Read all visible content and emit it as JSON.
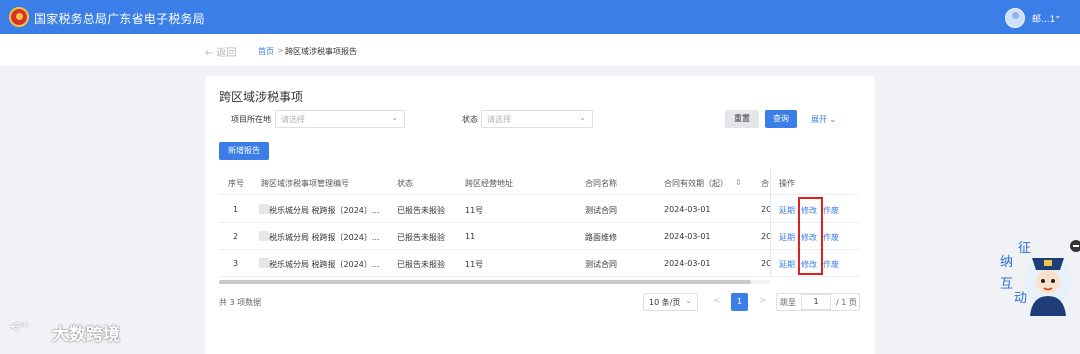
{
  "header": {
    "title": "国家税务总局广东省电子税务局",
    "user_name": "邮...1",
    "caret": "⌄"
  },
  "nav": {
    "back_label": "← 返回",
    "breadcrumb_home": "首页",
    "breadcrumb_sep": ">",
    "breadcrumb_current": "跨区域涉税事项报告"
  },
  "page": {
    "title": "跨区域涉税事项"
  },
  "filters": {
    "location_label": "项目所在地",
    "location_placeholder": "请选择",
    "status_label": "状态",
    "status_placeholder": "请选择",
    "reset_label": "重置",
    "query_label": "查询",
    "expand_label": "展开 ⌄",
    "add_label": "新增报告"
  },
  "table": {
    "columns": {
      "index": "序号",
      "code": "跨区域涉税事项管理编号",
      "status": "状态",
      "address": "跨区经营地址",
      "contract_name": "合同名称",
      "validity_start": "合同有效期（起）",
      "sort_icon": "⇕",
      "validity_end_partial": "合",
      "actions": "操作"
    },
    "rows": [
      {
        "index": "1",
        "code": "税乐城分局 税跨报〔2024〕...",
        "status": "已报告未报验",
        "address": "11号",
        "contract_name": "测试合同",
        "validity_start": "2024-03-01",
        "validity_end_partial": "2C",
        "action_extend": "延期",
        "action_modify": "修改",
        "action_void": "作废"
      },
      {
        "index": "2",
        "code": "税乐城分局 税跨报〔2024〕...",
        "status": "已报告未报验",
        "address": "11",
        "contract_name": "路面维修",
        "validity_start": "2024-03-01",
        "validity_end_partial": "2C",
        "action_extend": "延期",
        "action_modify": "修改",
        "action_void": "作废"
      },
      {
        "index": "3",
        "code": "税乐城分局 税跨报〔2024〕...",
        "status": "已报告未报验",
        "address": "11号",
        "contract_name": "测试合同",
        "validity_start": "2024-03-01",
        "validity_end_partial": "2C",
        "action_extend": "延期",
        "action_modify": "修改",
        "action_void": "作废"
      }
    ]
  },
  "pagination": {
    "total_label": "共 3 项数据",
    "page_size": "10 条/页",
    "size_caret": "⌄",
    "prev": "<",
    "current_page": "1",
    "next": ">",
    "jump_label": "跳至",
    "jump_value": "1",
    "total_pages": "/ 1 页"
  },
  "watermark": {
    "icon": "ᗕ⁰⁰",
    "text": "大数跨境"
  },
  "mascot": {
    "chars": [
      "征",
      "纳",
      "互",
      "动"
    ]
  },
  "colors": {
    "primary": "#3b7ee8",
    "highlight_border": "#e02020"
  }
}
